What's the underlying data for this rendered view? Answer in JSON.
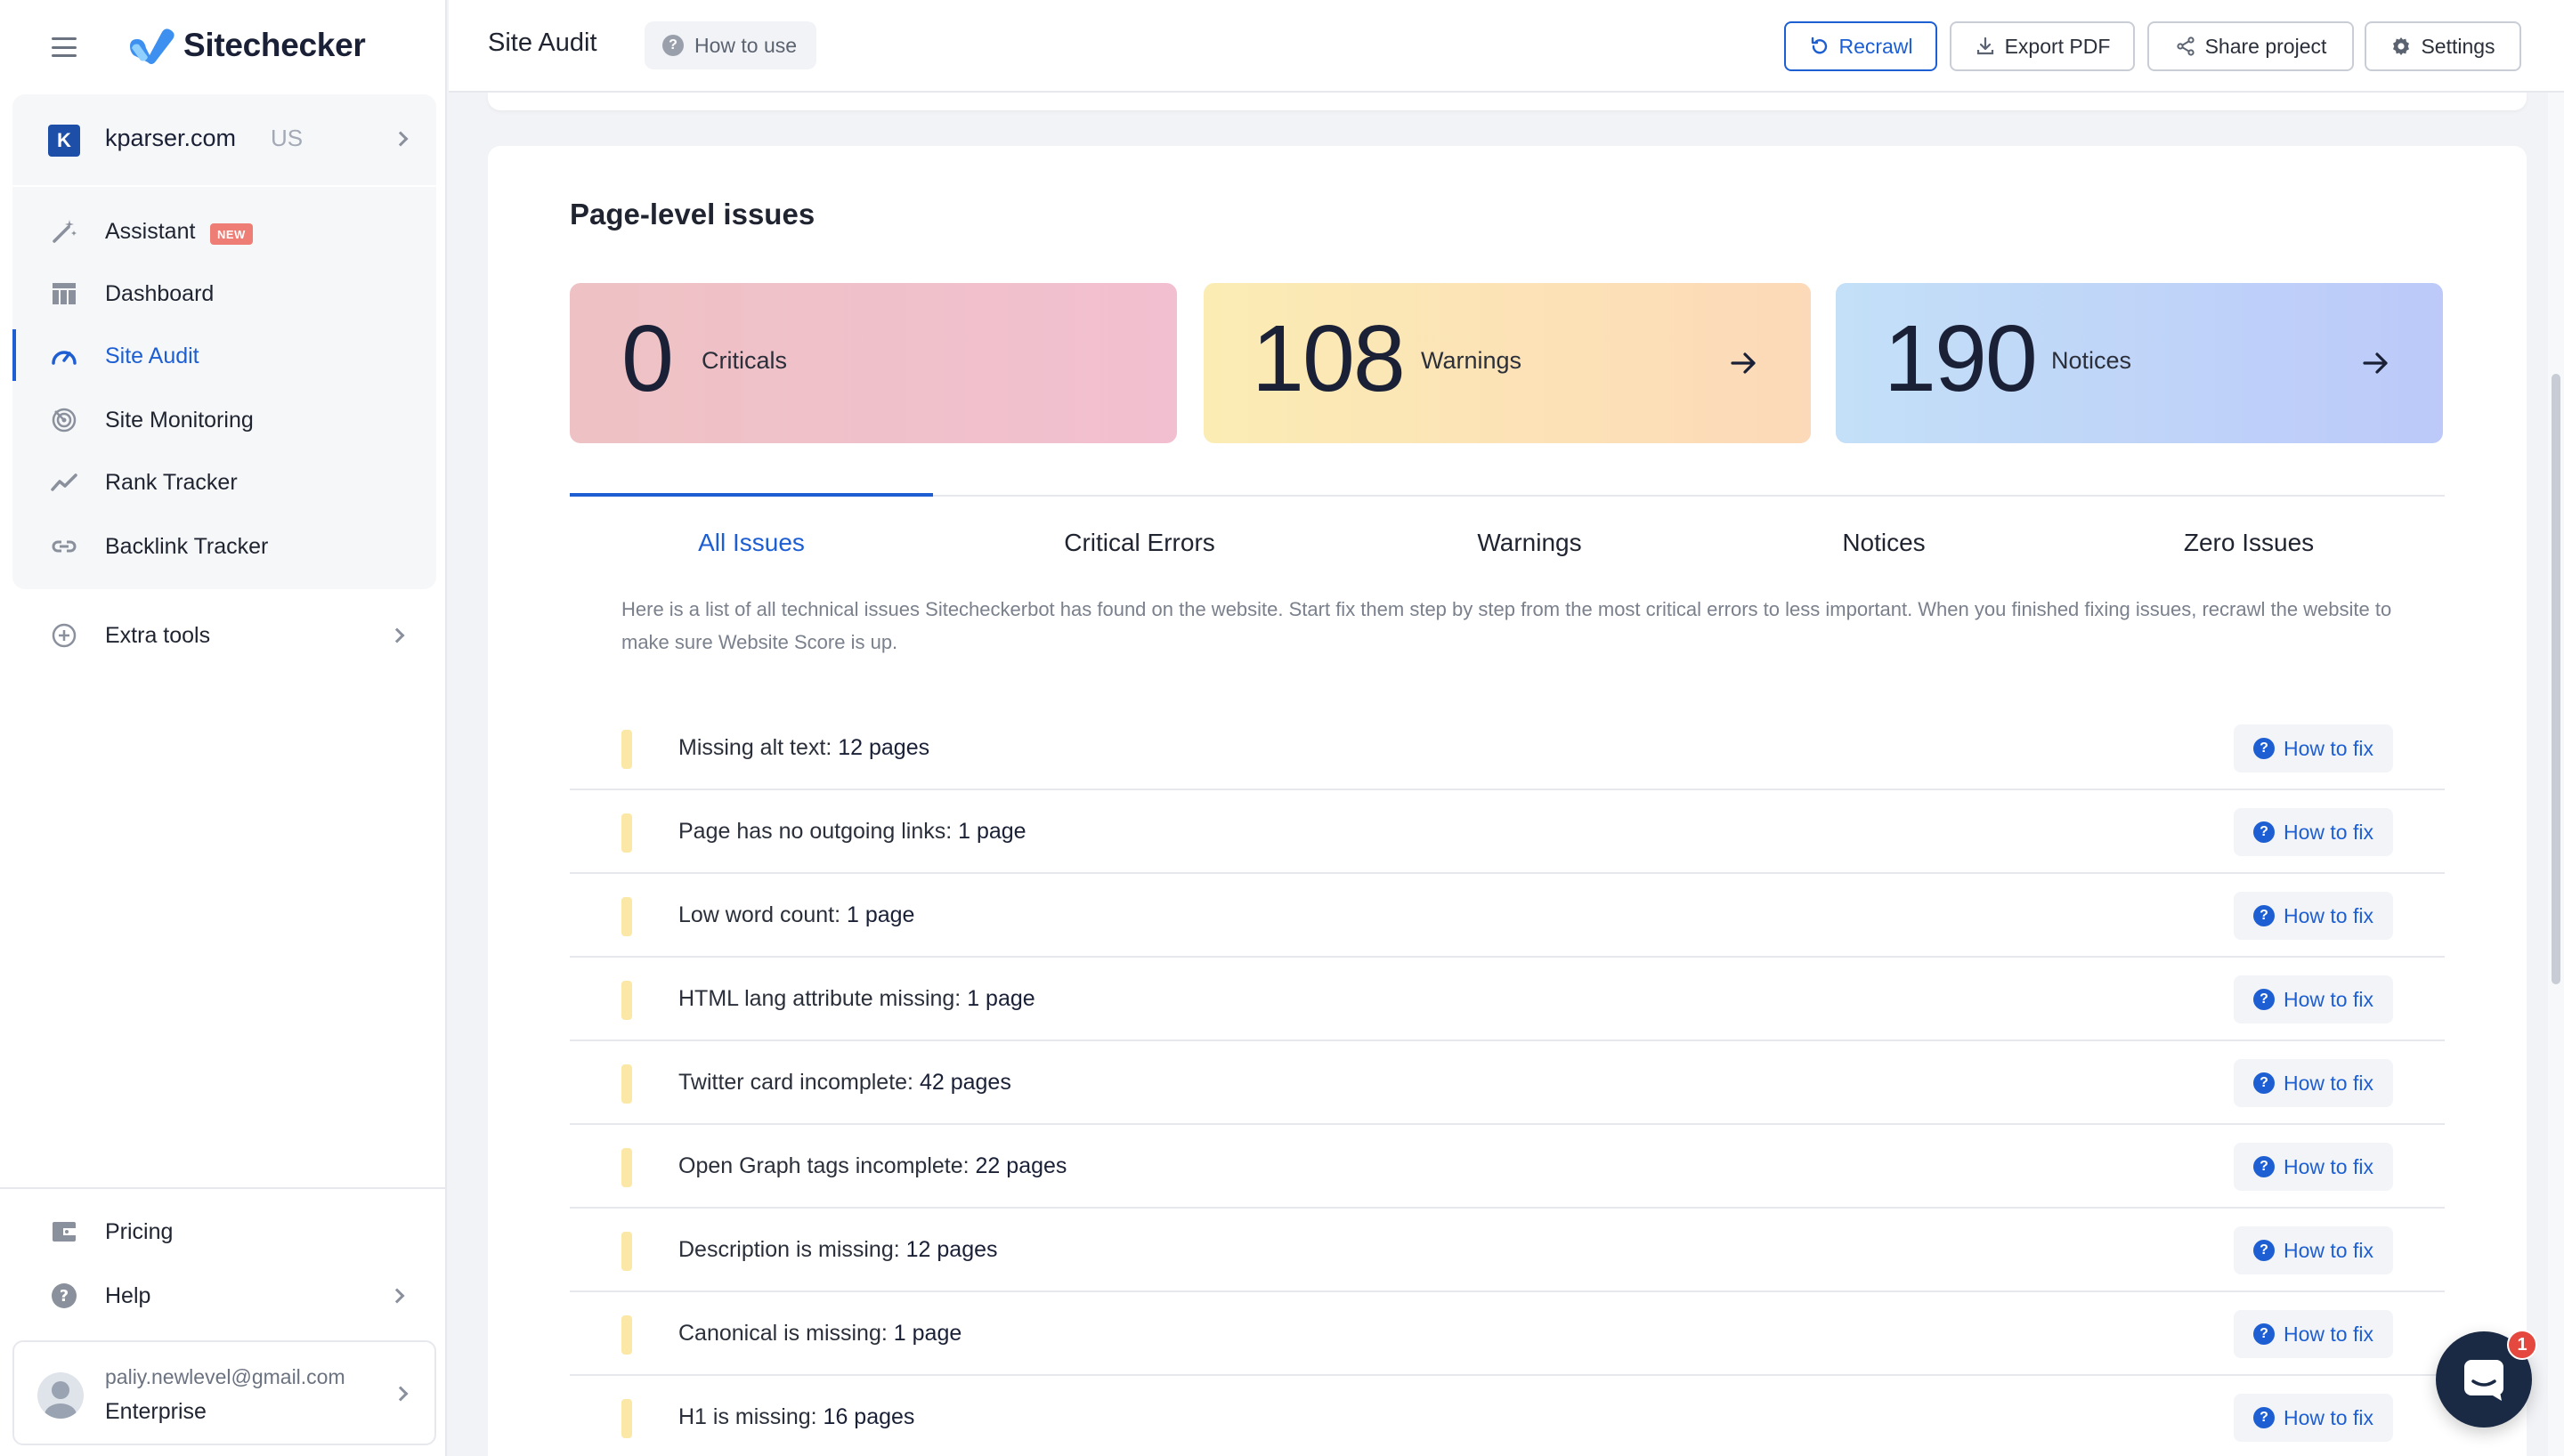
{
  "app": {
    "name": "Sitechecker",
    "page_title": "Site Audit",
    "how_to_use": "How to use"
  },
  "project": {
    "initial": "K",
    "domain": "kparser.com",
    "region": "US"
  },
  "nav": {
    "items": [
      {
        "label": "Assistant",
        "icon": "magic-wand-icon",
        "badge": "NEW"
      },
      {
        "label": "Dashboard",
        "icon": "dashboard-icon"
      },
      {
        "label": "Site Audit",
        "icon": "gauge-icon",
        "active": true
      },
      {
        "label": "Site Monitoring",
        "icon": "radar-icon"
      },
      {
        "label": "Rank Tracker",
        "icon": "trend-line-icon"
      },
      {
        "label": "Backlink Tracker",
        "icon": "link-icon"
      }
    ],
    "extra_tools": "Extra tools",
    "pricing": "Pricing",
    "help": "Help"
  },
  "user": {
    "email": "paliy.newlevel@gmail.com",
    "plan": "Enterprise"
  },
  "toolbar": {
    "recrawl": "Recrawl",
    "export_pdf": "Export PDF",
    "share_project": "Share project",
    "settings": "Settings"
  },
  "issues_summary": {
    "title": "Page-level issues",
    "criticals": {
      "count": "0",
      "label": "Criticals"
    },
    "warnings": {
      "count": "108",
      "label": "Warnings"
    },
    "notices": {
      "count": "190",
      "label": "Notices"
    }
  },
  "tabs": [
    "All Issues",
    "Critical Errors",
    "Warnings",
    "Notices",
    "Zero Issues"
  ],
  "description": "Here is a list of all technical issues Sitecheckerbot has found on the website. Start fix them step by step from the most critical errors to less important. When you finished fixing issues, recrawl the website to make sure Website Score is up.",
  "fix_label": "How to fix",
  "issues": [
    {
      "name": "Missing alt text:",
      "count": "12 pages"
    },
    {
      "name": "Page has no outgoing links:",
      "count": "1 page"
    },
    {
      "name": "Low word count:",
      "count": "1 page"
    },
    {
      "name": "HTML lang attribute missing:",
      "count": "1 page"
    },
    {
      "name": "Twitter card incomplete:",
      "count": "42 pages"
    },
    {
      "name": "Open Graph tags incomplete:",
      "count": "22 pages"
    },
    {
      "name": "Description is missing:",
      "count": "12 pages"
    },
    {
      "name": "Canonical is missing:",
      "count": "1 page"
    },
    {
      "name": "H1 is missing:",
      "count": "16 pages"
    }
  ],
  "chat": {
    "unread": "1"
  },
  "colors": {
    "accent": "#1d5fd3",
    "warning_bar": "#fce8a6",
    "sidebar_bg": "#f6f7f9"
  }
}
